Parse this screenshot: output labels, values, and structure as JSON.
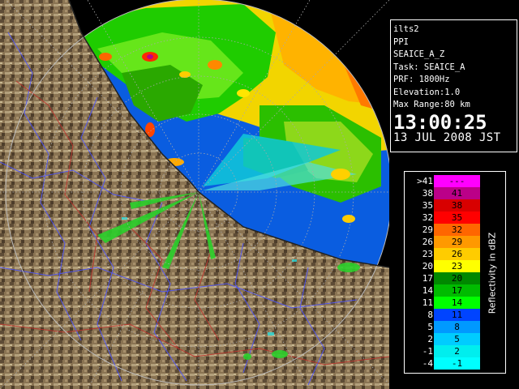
{
  "info": {
    "lines": [
      "ilts2",
      "PPI",
      "SEAICE_A_Z",
      "Task: SEAICE_A",
      "PRF: 1800Hz",
      "Elevation:1.0",
      "Max Range:80 km"
    ],
    "time": "13:00:25",
    "date": "13 JUL 2008 JST"
  },
  "legend": {
    "title": "Reflectivity in dBZ",
    "rows": [
      {
        "left": ">41",
        "right": "---",
        "color": "#ff00ff"
      },
      {
        "left": "38",
        "right": "41",
        "color": "#bb0088"
      },
      {
        "left": "35",
        "right": "38",
        "color": "#d80000"
      },
      {
        "left": "32",
        "right": "35",
        "color": "#ff0000"
      },
      {
        "left": "29",
        "right": "32",
        "color": "#ff6600"
      },
      {
        "left": "26",
        "right": "29",
        "color": "#ff9900"
      },
      {
        "left": "23",
        "right": "26",
        "color": "#ffcc00"
      },
      {
        "left": "20",
        "right": "23",
        "color": "#ffff00"
      },
      {
        "left": "17",
        "right": "20",
        "color": "#008800"
      },
      {
        "left": "14",
        "right": "17",
        "color": "#00bb00"
      },
      {
        "left": "11",
        "right": "14",
        "color": "#00ff00"
      },
      {
        "left": "8",
        "right": "11",
        "color": "#0044ff"
      },
      {
        "left": "5",
        "right": "8",
        "color": "#0099ff"
      },
      {
        "left": "2",
        "right": "5",
        "color": "#00ccff"
      },
      {
        "left": "-1",
        "right": "2",
        "color": "#00eeee"
      },
      {
        "left": "-4",
        "right": "-1",
        "color": "#00ffff"
      }
    ]
  }
}
